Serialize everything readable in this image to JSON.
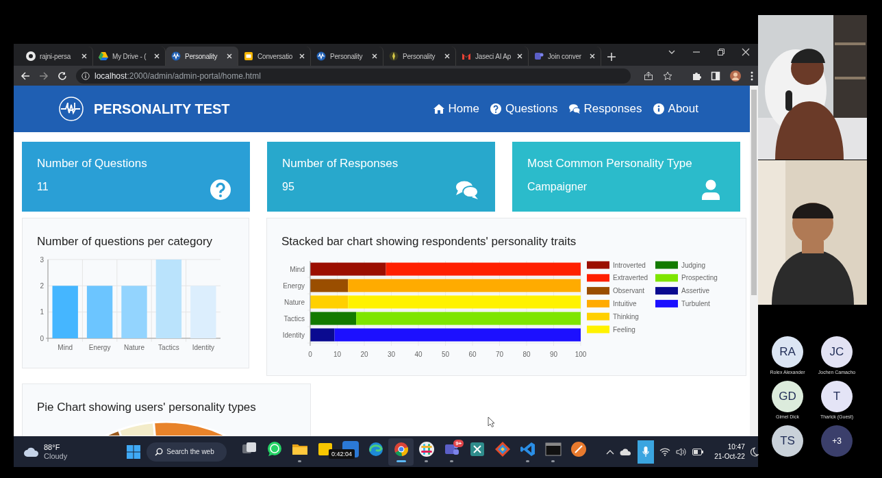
{
  "browser": {
    "tabs": [
      {
        "title": "rajni-persa",
        "selected": false
      },
      {
        "title": "My Drive - (",
        "selected": false
      },
      {
        "title": "Personality",
        "selected": true
      },
      {
        "title": "Conversatio",
        "selected": false
      },
      {
        "title": "Personality",
        "selected": false
      },
      {
        "title": "Personality",
        "selected": false
      },
      {
        "title": "Jaseci AI Ap",
        "selected": false
      },
      {
        "title": "Join conver",
        "selected": false
      }
    ],
    "address": {
      "host": "localhost",
      "path": ":2000/admin/admin-portal/home.html"
    }
  },
  "site": {
    "brand": "PERSONALITY TEST",
    "nav": [
      {
        "label": "Home"
      },
      {
        "label": "Questions"
      },
      {
        "label": "Responses"
      },
      {
        "label": "About"
      }
    ],
    "stats": [
      {
        "title": "Number of Questions",
        "value": "11",
        "color": "#2a9fd6"
      },
      {
        "title": "Number of Responses",
        "value": "95",
        "color": "#28a8cc"
      },
      {
        "title": "Most Common Personality Type",
        "value": "Campaigner",
        "color": "#2bbbcb"
      }
    ],
    "category_chart": {
      "title": "Number of questions per category",
      "chart_data": {
        "type": "bar",
        "categories": [
          "Mind",
          "Energy",
          "Nature",
          "Tactics",
          "Identity"
        ],
        "values": [
          2,
          2,
          2,
          3,
          2
        ],
        "colors": [
          "#45b6ff",
          "#6cc5ff",
          "#93d4fe",
          "#bae3fc",
          "#dceefd"
        ],
        "ylim": [
          0,
          3
        ],
        "yticks": [
          0,
          1,
          2,
          3
        ]
      }
    },
    "traits_chart": {
      "title": "Stacked bar chart showing respondents' personality traits",
      "chart_data": {
        "type": "bar",
        "orientation": "horizontal",
        "stacked": true,
        "categories": [
          "Mind",
          "Energy",
          "Nature",
          "Tactics",
          "Identity"
        ],
        "xlim": [
          0,
          100
        ],
        "grid": true,
        "legend": true,
        "xticks": [
          0,
          10,
          20,
          30,
          40,
          50,
          60,
          70,
          80,
          90,
          100
        ],
        "series": [
          {
            "name": "Introverted",
            "color": "#9b0e00",
            "values": [
              28,
              null,
              null,
              null,
              null
            ]
          },
          {
            "name": "Extraverted",
            "color": "#ff2000",
            "values": [
              72,
              null,
              null,
              null,
              null
            ]
          },
          {
            "name": "Observant",
            "color": "#9a4e00",
            "values": [
              null,
              14,
              null,
              null,
              null
            ]
          },
          {
            "name": "Intuitive",
            "color": "#ffab00",
            "values": [
              null,
              86,
              null,
              null,
              null
            ]
          },
          {
            "name": "Thinking",
            "color": "#ffd000",
            "values": [
              null,
              null,
              14,
              null,
              null
            ]
          },
          {
            "name": "Feeling",
            "color": "#fff200",
            "values": [
              null,
              null,
              86,
              null,
              null
            ]
          },
          {
            "name": "Judging",
            "color": "#137a00",
            "values": [
              null,
              null,
              null,
              17,
              null
            ]
          },
          {
            "name": "Prospecting",
            "color": "#7ee500",
            "values": [
              null,
              null,
              null,
              83,
              null
            ]
          },
          {
            "name": "Assertive",
            "color": "#0a0a90",
            "values": [
              null,
              null,
              null,
              null,
              9
            ]
          },
          {
            "name": "Turbulent",
            "color": "#1c10ff",
            "values": [
              null,
              null,
              null,
              null,
              91
            ]
          }
        ]
      }
    },
    "pie_chart": {
      "title": "Pie Chart showing users' personality types"
    }
  },
  "taskbar": {
    "weather": {
      "temperature": "88°F",
      "condition": "Cloudy"
    },
    "search": {
      "placeholder": "Search the web"
    },
    "apps": [
      {
        "running": false,
        "selected": false
      },
      {
        "running": false,
        "selected": false
      },
      {
        "running": true,
        "selected": false
      },
      {
        "running": false,
        "selected": false
      },
      {
        "running": false,
        "selected": false
      },
      {
        "running": false,
        "selected": false
      },
      {
        "running": true,
        "selected": true
      },
      {
        "running": true,
        "selected": false
      },
      {
        "running": true,
        "selected": false,
        "badge": "9+"
      },
      {
        "running": false,
        "selected": false
      },
      {
        "running": false,
        "selected": false
      },
      {
        "running": true,
        "selected": false
      },
      {
        "running": true,
        "selected": false
      },
      {
        "running": false,
        "selected": false
      }
    ],
    "tooltip": "0:42:04",
    "mic_on": true,
    "clock": {
      "time": "10:47",
      "date": "21-Oct-22"
    }
  },
  "call": {
    "participants": [
      {
        "initials": "RA",
        "name": "Rolex Alexander",
        "color": "#dbe5f3"
      },
      {
        "initials": "JC",
        "name": "Jochen Camacho",
        "color": "#e2e2f3"
      },
      {
        "initials": "GD",
        "name": "Gimel Dick",
        "color": "#dcebdc"
      },
      {
        "initials": "T",
        "name": "Tharick (Guest)",
        "color": "#e4e4f6"
      },
      {
        "initials": "TS",
        "color": "#c9d1d9"
      },
      {
        "initials": "+3",
        "color": "#3b3f6b"
      }
    ]
  }
}
